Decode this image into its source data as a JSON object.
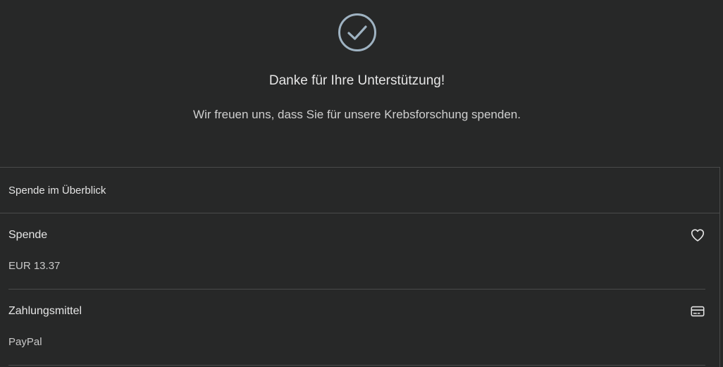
{
  "confirmation": {
    "icon": "check-circle-icon",
    "title": "Danke für Ihre Unterstützung!",
    "message": "Wir freuen uns, dass Sie für unsere Krebsforschung spenden."
  },
  "summary": {
    "heading": "Spende im Überblick",
    "items": [
      {
        "label": "Spende",
        "value": "EUR 13.37",
        "icon": "heart-icon"
      },
      {
        "label": "Zahlungsmittel",
        "value": "PayPal",
        "icon": "credit-card-icon"
      }
    ]
  },
  "colors": {
    "background": "#272828",
    "divider": "#4a4b4b",
    "icon_accent": "#9fb3c2"
  }
}
